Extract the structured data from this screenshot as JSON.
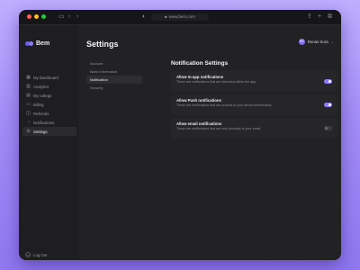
{
  "browser": {
    "url": "www.bem.com"
  },
  "app": {
    "logo_text": "Bem",
    "page_title": "Settings"
  },
  "user": {
    "name": "Ronan Sora",
    "initials": "RS"
  },
  "sidebar": {
    "items": [
      {
        "label": "My Dashboard",
        "icon": "grid-icon",
        "active": false
      },
      {
        "label": "Analytics",
        "icon": "chart-icon",
        "active": false
      },
      {
        "label": "My college",
        "icon": "building-icon",
        "active": false
      },
      {
        "label": "Billing",
        "icon": "card-icon",
        "active": false
      },
      {
        "label": "Referrals",
        "icon": "gift-icon",
        "active": false
      },
      {
        "label": "Notifications",
        "icon": "bell-icon",
        "active": false
      },
      {
        "label": "Settings",
        "icon": "gear-icon",
        "active": true
      }
    ],
    "logout_label": "Log Out"
  },
  "subnav": {
    "items": [
      {
        "label": "Account",
        "active": false
      },
      {
        "label": "Bank Information",
        "active": false
      },
      {
        "label": "Notification",
        "active": true
      },
      {
        "label": "Security",
        "active": false
      }
    ]
  },
  "notifications": {
    "title": "Notification Settings",
    "settings": [
      {
        "label": "Allow In-app notifications",
        "description": "These are notifications that are delivered within the app",
        "enabled": true
      },
      {
        "label": "Allow Push notifications",
        "description": "These are notifications that are pushed to your device immediately",
        "enabled": true
      },
      {
        "label": "Allow email notifications",
        "description": "These are notifications that are sent primarily to your email",
        "enabled": false
      }
    ]
  },
  "colors": {
    "accent": "#8d7df5",
    "background": "#1e1e20",
    "panel": "#222225"
  }
}
